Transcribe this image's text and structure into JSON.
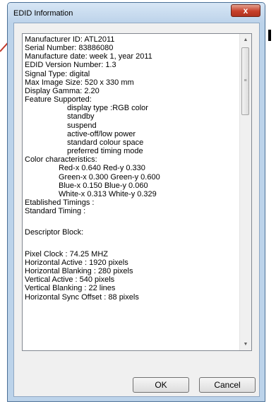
{
  "dialog": {
    "title": "EDID Information",
    "close_glyph": "x",
    "ok_label": "OK",
    "cancel_label": "Cancel"
  },
  "icons": {
    "close": "close-icon",
    "scroll_up": "scroll-up-arrow-icon",
    "scroll_down": "scroll-down-arrow-icon",
    "scroll_grip": "scroll-grip-icon"
  },
  "colors": {
    "close_button": "#c7402a",
    "window_frame": "#bcd3ea",
    "background_stroke": "#c0392b"
  },
  "edid": {
    "manufacturer_id": "Manufacturer ID: ATL2011",
    "serial_number": "Serial Number: 83886080",
    "manufacture_date": "Manufacture date: week 1, year 2011",
    "version": "EDID Version Number: 1.3",
    "signal_type": "Signal Type: digital",
    "max_image_size": "Max Image Size: 520 x 330 mm",
    "display_gamma": "Display Gamma: 2.20",
    "feature_header": "Feature Supported:",
    "features": [
      "display type :RGB color",
      "standby",
      "suspend",
      "active-off/low power",
      "standard colour space",
      "preferred timing mode"
    ],
    "color_header": "Color characteristics:",
    "colors": [
      "Red-x 0.640  Red-y 0.330",
      "Green-x 0.300  Green-y 0.600",
      "Blue-x 0.150  Blue-y 0.060",
      "White-x 0.313  White-y 0.329"
    ],
    "established_timings": "Etablished Timings :",
    "standard_timing": "Standard Timing :",
    "descriptor_block": "Descriptor Block:",
    "descriptor": [
      "Pixel Clock : 74.25 MHZ",
      "Horizontal Active : 1920 pixels",
      "Horizontal Blanking : 280 pixels",
      "Vertical Active : 540 pixels",
      "Vertical Blanking : 22 lines",
      "Horizontal Sync Offset : 88 pixels"
    ]
  }
}
